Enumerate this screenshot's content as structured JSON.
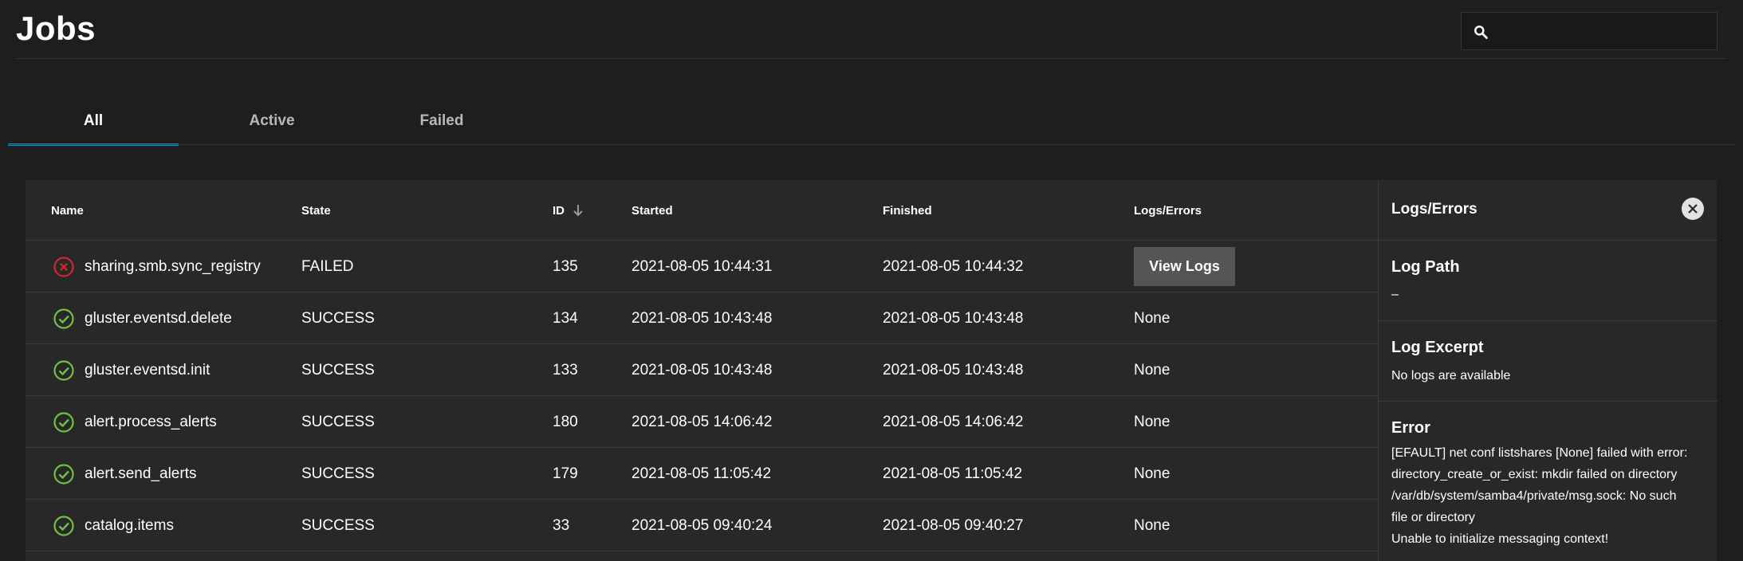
{
  "header": {
    "title": "Jobs",
    "search": {
      "value": "",
      "placeholder": ""
    }
  },
  "tabs": [
    {
      "label": "All",
      "active": true
    },
    {
      "label": "Active",
      "active": false
    },
    {
      "label": "Failed",
      "active": false
    }
  ],
  "table": {
    "columns": {
      "name": "Name",
      "state": "State",
      "id": "ID",
      "started": "Started",
      "finished": "Finished",
      "logs": "Logs/Errors"
    },
    "rows": [
      {
        "status_icon": "error-circle-icon",
        "name": "sharing.smb.sync_registry",
        "state": "FAILED",
        "id": "135",
        "started": "2021-08-05 10:44:31",
        "finished": "2021-08-05 10:44:32",
        "logs": "View Logs"
      },
      {
        "status_icon": "check-circle-icon",
        "name": "gluster.eventsd.delete",
        "state": "SUCCESS",
        "id": "134",
        "started": "2021-08-05 10:43:48",
        "finished": "2021-08-05 10:43:48",
        "logs": "None"
      },
      {
        "status_icon": "check-circle-icon",
        "name": "gluster.eventsd.init",
        "state": "SUCCESS",
        "id": "133",
        "started": "2021-08-05 10:43:48",
        "finished": "2021-08-05 10:43:48",
        "logs": "None"
      },
      {
        "status_icon": "check-circle-icon",
        "name": "alert.process_alerts",
        "state": "SUCCESS",
        "id": "180",
        "started": "2021-08-05 14:06:42",
        "finished": "2021-08-05 14:06:42",
        "logs": "None"
      },
      {
        "status_icon": "check-circle-icon",
        "name": "alert.send_alerts",
        "state": "SUCCESS",
        "id": "179",
        "started": "2021-08-05 11:05:42",
        "finished": "2021-08-05 11:05:42",
        "logs": "None"
      },
      {
        "status_icon": "check-circle-icon",
        "name": "catalog.items",
        "state": "SUCCESS",
        "id": "33",
        "started": "2021-08-05 09:40:24",
        "finished": "2021-08-05 09:40:27",
        "logs": "None"
      }
    ]
  },
  "panel": {
    "title": "Logs/Errors",
    "log_path_heading": "Log Path",
    "log_path_value": "–",
    "log_excerpt_heading": "Log Excerpt",
    "log_excerpt_value": "No logs are available",
    "error_heading": "Error",
    "error_lines": [
      "[EFAULT] net conf listshares [None] failed with error:",
      "directory_create_or_exist: mkdir failed on directory",
      "/var/db/system/samba4/private/msg.sock: No such",
      "file or directory",
      "Unable to initialize messaging context!"
    ]
  },
  "colors": {
    "background": "#1e1e1e",
    "card": "#282828",
    "accent": "#0095d5",
    "success": "#71bf44",
    "error": "#ce2929"
  }
}
